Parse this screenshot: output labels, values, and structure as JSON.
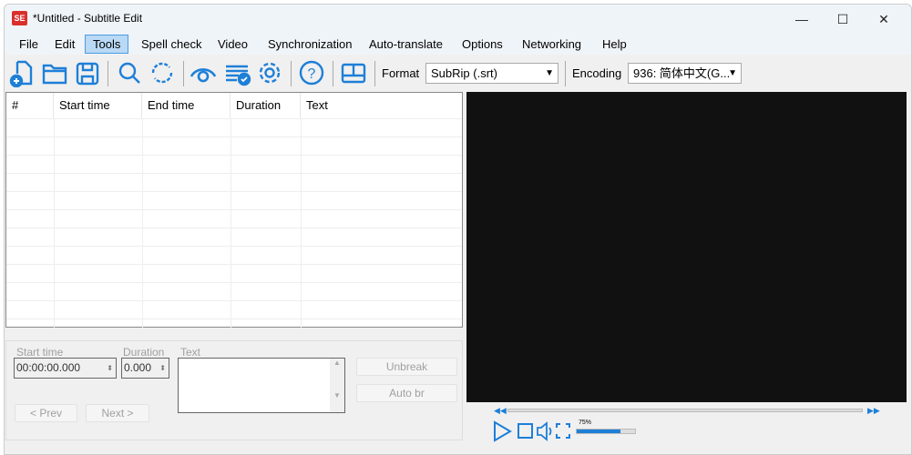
{
  "window": {
    "title": "*Untitled - Subtitle Edit",
    "logo": "SE",
    "minimize": "—",
    "maximize": "☐",
    "close": "✕"
  },
  "menu": [
    "File",
    "Edit",
    "Tools",
    "Spell check",
    "Video",
    "Synchronization",
    "Auto-translate",
    "Options",
    "Networking",
    "Help"
  ],
  "menu_active": "Tools",
  "toolbar": {
    "icons": [
      "new-file-icon",
      "open-folder-icon",
      "save-icon",
      "find-icon",
      "replace-icon",
      "visual-sync-icon",
      "spell-check-icon",
      "settings-icon",
      "help-icon",
      "layout-icon"
    ],
    "format_label": "Format",
    "format_value": "SubRip (.srt)",
    "encoding_label": "Encoding",
    "encoding_value": "936: 简体中文(G..."
  },
  "grid": {
    "columns": [
      "#",
      "Start time",
      "End time",
      "Duration",
      "Text"
    ],
    "rows": []
  },
  "edit": {
    "start_time_label": "Start time",
    "start_time_value": "00:00:00.000",
    "duration_label": "Duration",
    "duration_value": "0.000",
    "text_label": "Text",
    "text_value": "",
    "unbreak": "Unbreak",
    "auto_br": "Auto br",
    "prev": "< Prev",
    "next": "Next >"
  },
  "player": {
    "volume_label": "75%",
    "volume": 75,
    "position": 0
  },
  "colors": {
    "accent": "#1e7fd8",
    "video_bg": "#111111"
  }
}
